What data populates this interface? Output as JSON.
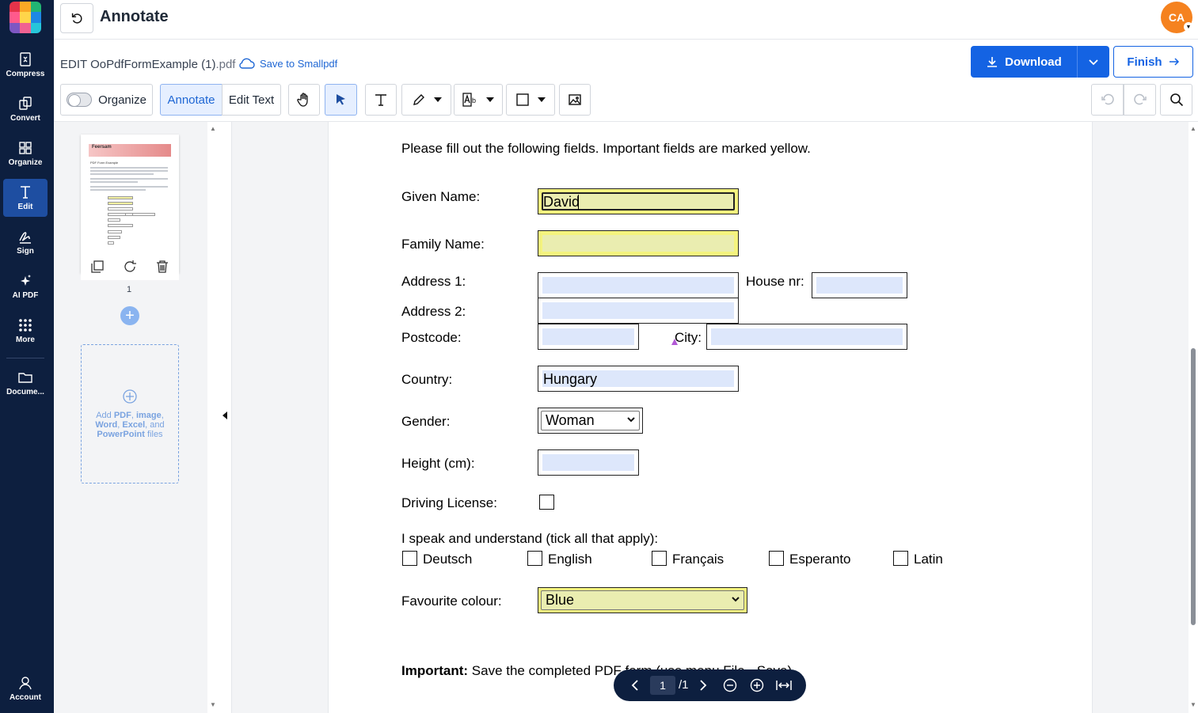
{
  "app": {
    "title": "Annotate",
    "avatar_initials": "CA"
  },
  "nav": {
    "items": [
      {
        "label": "Compress",
        "icon": "compress-icon"
      },
      {
        "label": "Convert",
        "icon": "convert-icon"
      },
      {
        "label": "Organize",
        "icon": "organize-icon"
      },
      {
        "label": "Edit",
        "icon": "edit-icon"
      },
      {
        "label": "Sign",
        "icon": "sign-icon"
      },
      {
        "label": "AI PDF",
        "icon": "sparkle-icon"
      },
      {
        "label": "More",
        "icon": "grid-icon"
      },
      {
        "label": "Docume...",
        "icon": "folder-icon"
      }
    ],
    "account_label": "Account"
  },
  "file": {
    "name_main": "EDIT OoPdfFormExample (1)",
    "name_ext": ".pdf",
    "save_link": "Save to Smallpdf"
  },
  "actions": {
    "download": "Download",
    "finish": "Finish"
  },
  "toolbar": {
    "organize": "Organize",
    "annotate": "Annotate",
    "edit_text": "Edit Text"
  },
  "sidebar": {
    "page_number": "1",
    "thumb_title": "Feersam",
    "thumb_subtitle": "PDF Form Example",
    "dropzone": {
      "add": "Add ",
      "pdf": "PDF",
      "comma1": ", ",
      "image": "image",
      "comma2": ",",
      "word": "Word",
      "comma3": ", ",
      "excel": "Excel",
      "and": ", and",
      "ppt": "PowerPoint",
      "files": " files"
    }
  },
  "form": {
    "intro": "Please fill out the following fields. Important fields are marked yellow.",
    "given_name_label": "Given Name:",
    "given_name_value": "David",
    "family_name_label": "Family Name:",
    "address1_label": "Address 1:",
    "house_nr_label": "House nr:",
    "address2_label": "Address 2:",
    "postcode_label": "Postcode:",
    "city_label": "City:",
    "country_label": "Country:",
    "country_value": "Hungary",
    "gender_label": "Gender:",
    "gender_value": "Woman",
    "height_label": "Height (cm):",
    "license_label": "Driving License:",
    "languages_label": "I speak and understand (tick all that apply):",
    "languages": [
      "Deutsch",
      "English",
      "Français",
      "Esperanto",
      "Latin"
    ],
    "colour_label": "Favourite colour:",
    "colour_value": "Blue",
    "important_bold": "Important:",
    "important_text": " Save the completed PDF form (use menu File - Save)."
  },
  "pager": {
    "current": "1",
    "total": "/1"
  },
  "colors": {
    "brand_blue": "#1463e3",
    "nav_bg": "#0d1f3f",
    "field_yellow": "#f4f37e",
    "field_blue": "#dde7fb"
  }
}
